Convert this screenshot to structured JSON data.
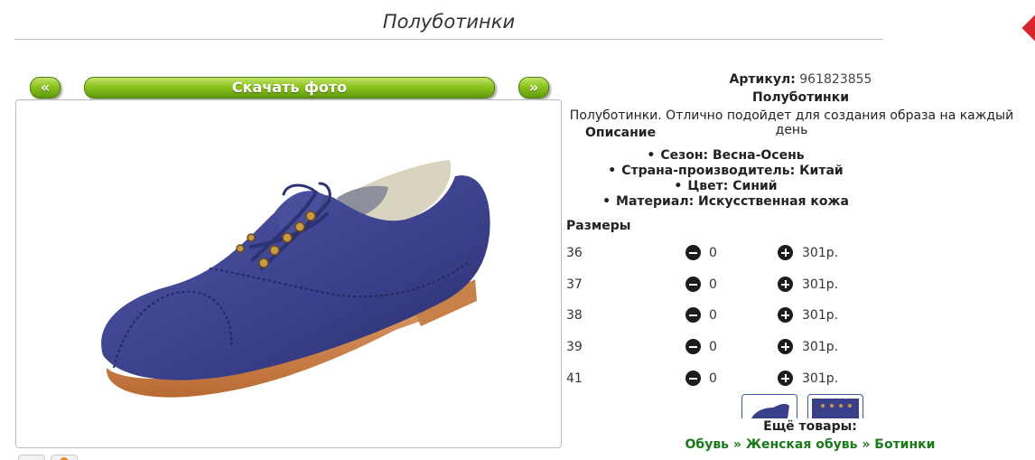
{
  "product": {
    "title": "Полуботинки",
    "sku_label": "Артикул:",
    "sku_value": "961823855",
    "name": "Полуботинки",
    "summary": "Полуботинки. Отлично подойдет для создания образа на каждый день",
    "description_heading": "Описание",
    "attributes": [
      "Сезон: Весна-Осень",
      "Страна-производитель: Китай",
      "Цвет: Синий",
      "Материал: Искусственная кожа"
    ]
  },
  "gallery": {
    "prev_label": "«",
    "download_label": "Скачать фото",
    "next_label": "»"
  },
  "sizes": {
    "heading": "Размеры",
    "rows": [
      {
        "size": "36",
        "qty": "0",
        "price": "301р."
      },
      {
        "size": "37",
        "qty": "0",
        "price": "301р."
      },
      {
        "size": "38",
        "qty": "0",
        "price": "301р."
      },
      {
        "size": "39",
        "qty": "0",
        "price": "301р."
      },
      {
        "size": "41",
        "qty": "0",
        "price": "301р."
      }
    ]
  },
  "more": {
    "heading": "Ещё товары:",
    "crumbs": [
      "Обувь",
      "Женская обувь",
      "Ботинки"
    ],
    "separator": "»"
  },
  "colors": {
    "accent_green": "#8cc31e",
    "link_green": "#1a7a1a",
    "shoe_blue": "#3a3f8a"
  }
}
